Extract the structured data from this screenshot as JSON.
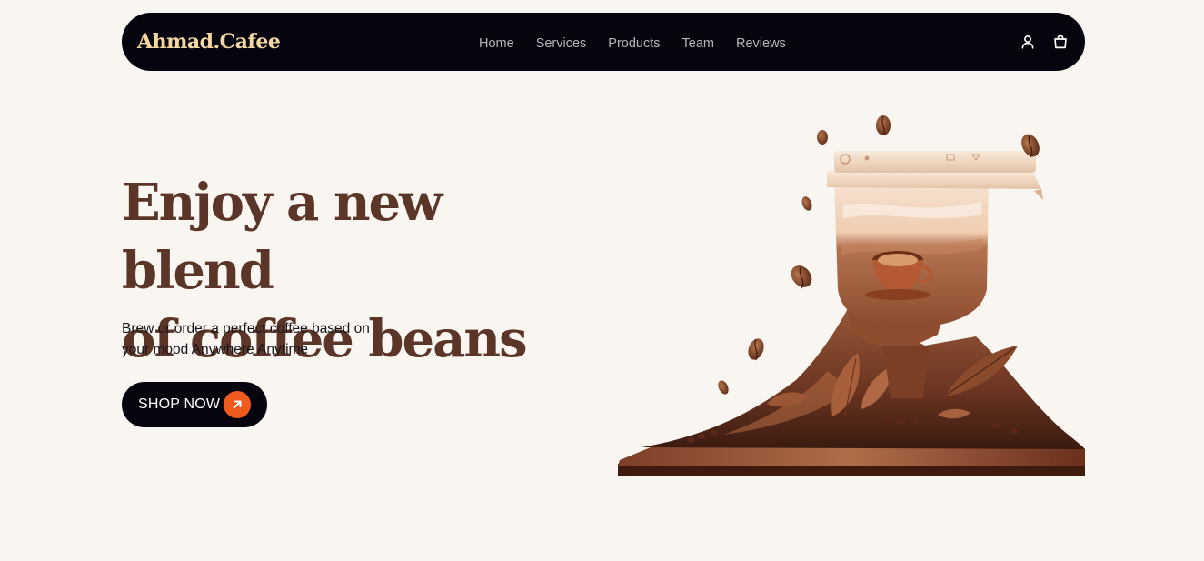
{
  "brand": {
    "name": "Ahmad.Cafee",
    "color": "#f5d7a1"
  },
  "nav": {
    "items": [
      {
        "label": "Home"
      },
      {
        "label": "Services"
      },
      {
        "label": "Products"
      },
      {
        "label": "Team"
      },
      {
        "label": "Reviews"
      }
    ],
    "icons": [
      "user-icon",
      "shopping-bag-icon"
    ]
  },
  "hero": {
    "title_line1": "Enjoy a new blend",
    "title_line2": "of coffee beans",
    "subtitle_line1": "Brew or order a perfect coffee based on",
    "subtitle_line2": "your mood Anywhere Anytime",
    "cta_label": "SHOP NOW",
    "cta_icon": "arrow-up-right-icon",
    "image": "coffee-grinder-illustration"
  },
  "colors": {
    "background": "#f9f5f1",
    "navbar": "#05040f",
    "title": "#5b3628",
    "accent": "#f15a1f"
  }
}
